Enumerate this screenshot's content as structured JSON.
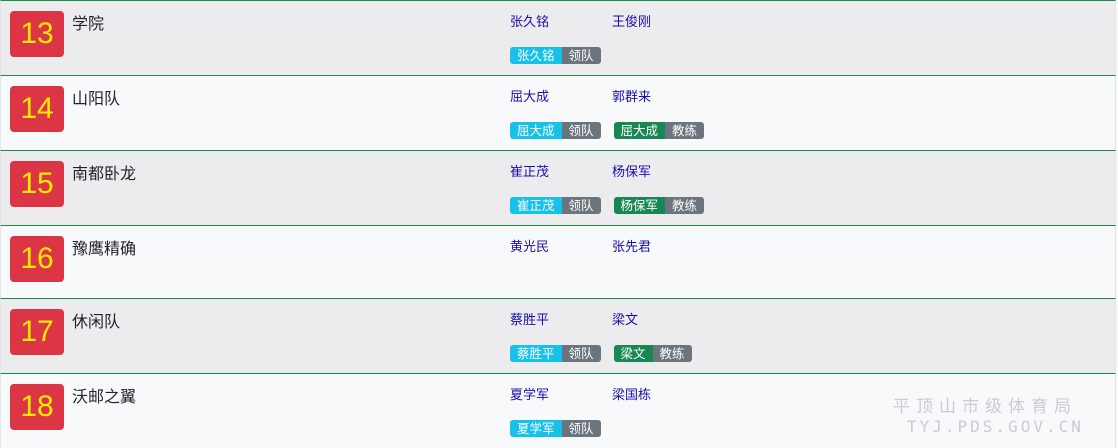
{
  "rows": [
    {
      "rank": "13",
      "team": "学院",
      "members": [
        "张久铭",
        "王俊刚"
      ],
      "badges": [
        {
          "name": "张久铭",
          "role": "领队",
          "type": "leader"
        }
      ]
    },
    {
      "rank": "14",
      "team": "山阳队",
      "members": [
        "屈大成",
        "郭群来"
      ],
      "badges": [
        {
          "name": "屈大成",
          "role": "领队",
          "type": "leader"
        },
        {
          "name": "屈大成",
          "role": "教练",
          "type": "coach"
        }
      ]
    },
    {
      "rank": "15",
      "team": "南都卧龙",
      "members": [
        "崔正茂",
        "杨保军"
      ],
      "badges": [
        {
          "name": "崔正茂",
          "role": "领队",
          "type": "leader"
        },
        {
          "name": "杨保军",
          "role": "教练",
          "type": "coach"
        }
      ]
    },
    {
      "rank": "16",
      "team": "豫鹰精确",
      "members": [
        "黄光民",
        "张先君"
      ],
      "badges": []
    },
    {
      "rank": "17",
      "team": "休闲队",
      "members": [
        "蔡胜平",
        "梁文"
      ],
      "badges": [
        {
          "name": "蔡胜平",
          "role": "领队",
          "type": "leader"
        },
        {
          "name": "梁文",
          "role": "教练",
          "type": "coach"
        }
      ]
    },
    {
      "rank": "18",
      "team": "沃邮之翼",
      "members": [
        "夏学军",
        "梁国栋"
      ],
      "badges": [
        {
          "name": "夏学军",
          "role": "领队",
          "type": "leader"
        }
      ]
    }
  ],
  "watermark": {
    "line1": "平顶山市级体育局",
    "line2": "TYJ.PDS.GOV.CN"
  },
  "colors": {
    "rank_bg": "#dc3545",
    "rank_text": "#ffeb00",
    "leader": "#17c1e8",
    "coach": "#198754",
    "role_bg": "#6c757d",
    "divider": "#1e8a4a"
  }
}
